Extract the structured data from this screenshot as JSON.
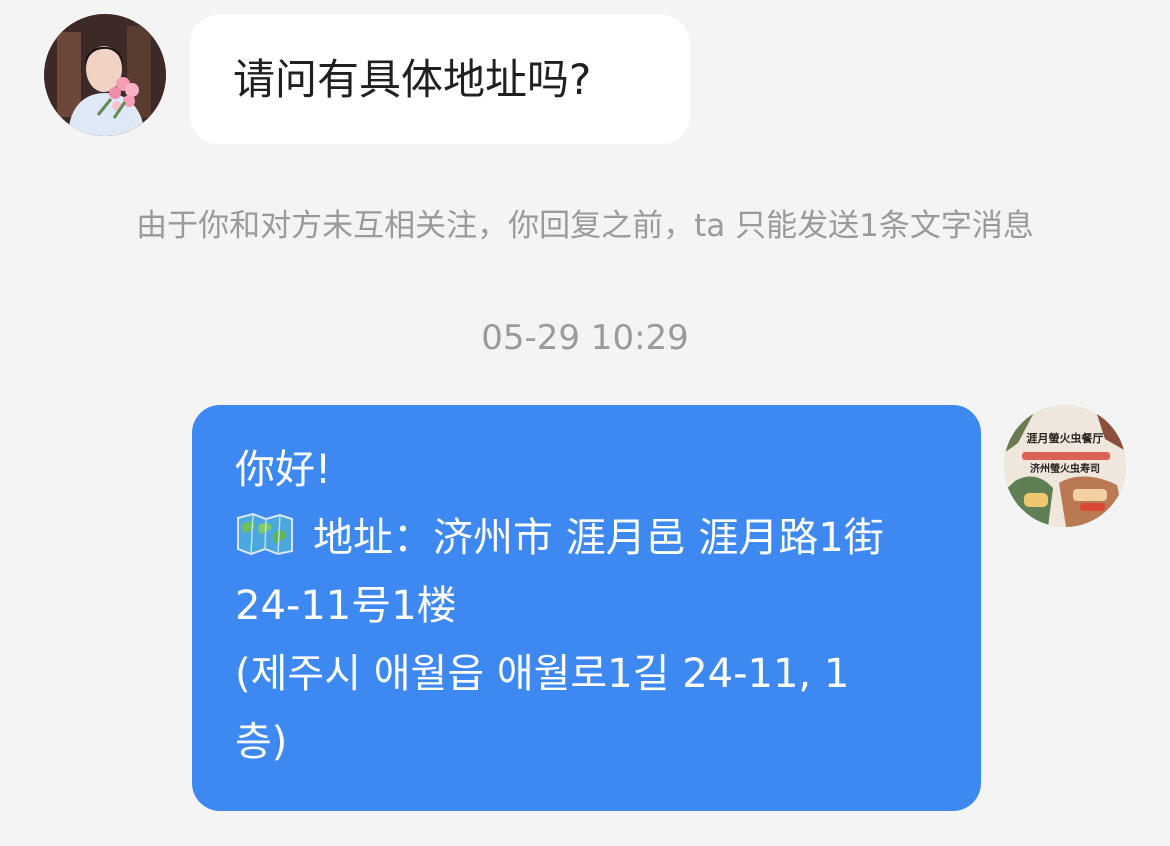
{
  "messages": {
    "incoming": {
      "text": "请问有具体地址吗?"
    },
    "system_note": "由于你和对方未互相关注，你回复之前，ta 只能发送1条文字消息",
    "timestamp": "05-29 10:29",
    "outgoing": {
      "greeting": "你好!",
      "address_line_1": "地址：济州市 涯月邑 涯月路1街",
      "address_line_2": "24-11号1楼",
      "korean_line_1": "(제주시 애월읍 애월로1길 24-11, 1",
      "korean_line_2": "층)",
      "icon": "world-map-icon"
    },
    "avatar_right": {
      "lines": [
        "涯月螢火虫餐厅",
        "济州螢火虫寿司"
      ]
    }
  },
  "colors": {
    "background": "#f4f4f4",
    "incoming_bubble": "#ffffff",
    "outgoing_bubble": "#3d89f1",
    "text_dark": "#202020",
    "text_muted": "#9a9a9a",
    "text_light": "#ffffff"
  }
}
